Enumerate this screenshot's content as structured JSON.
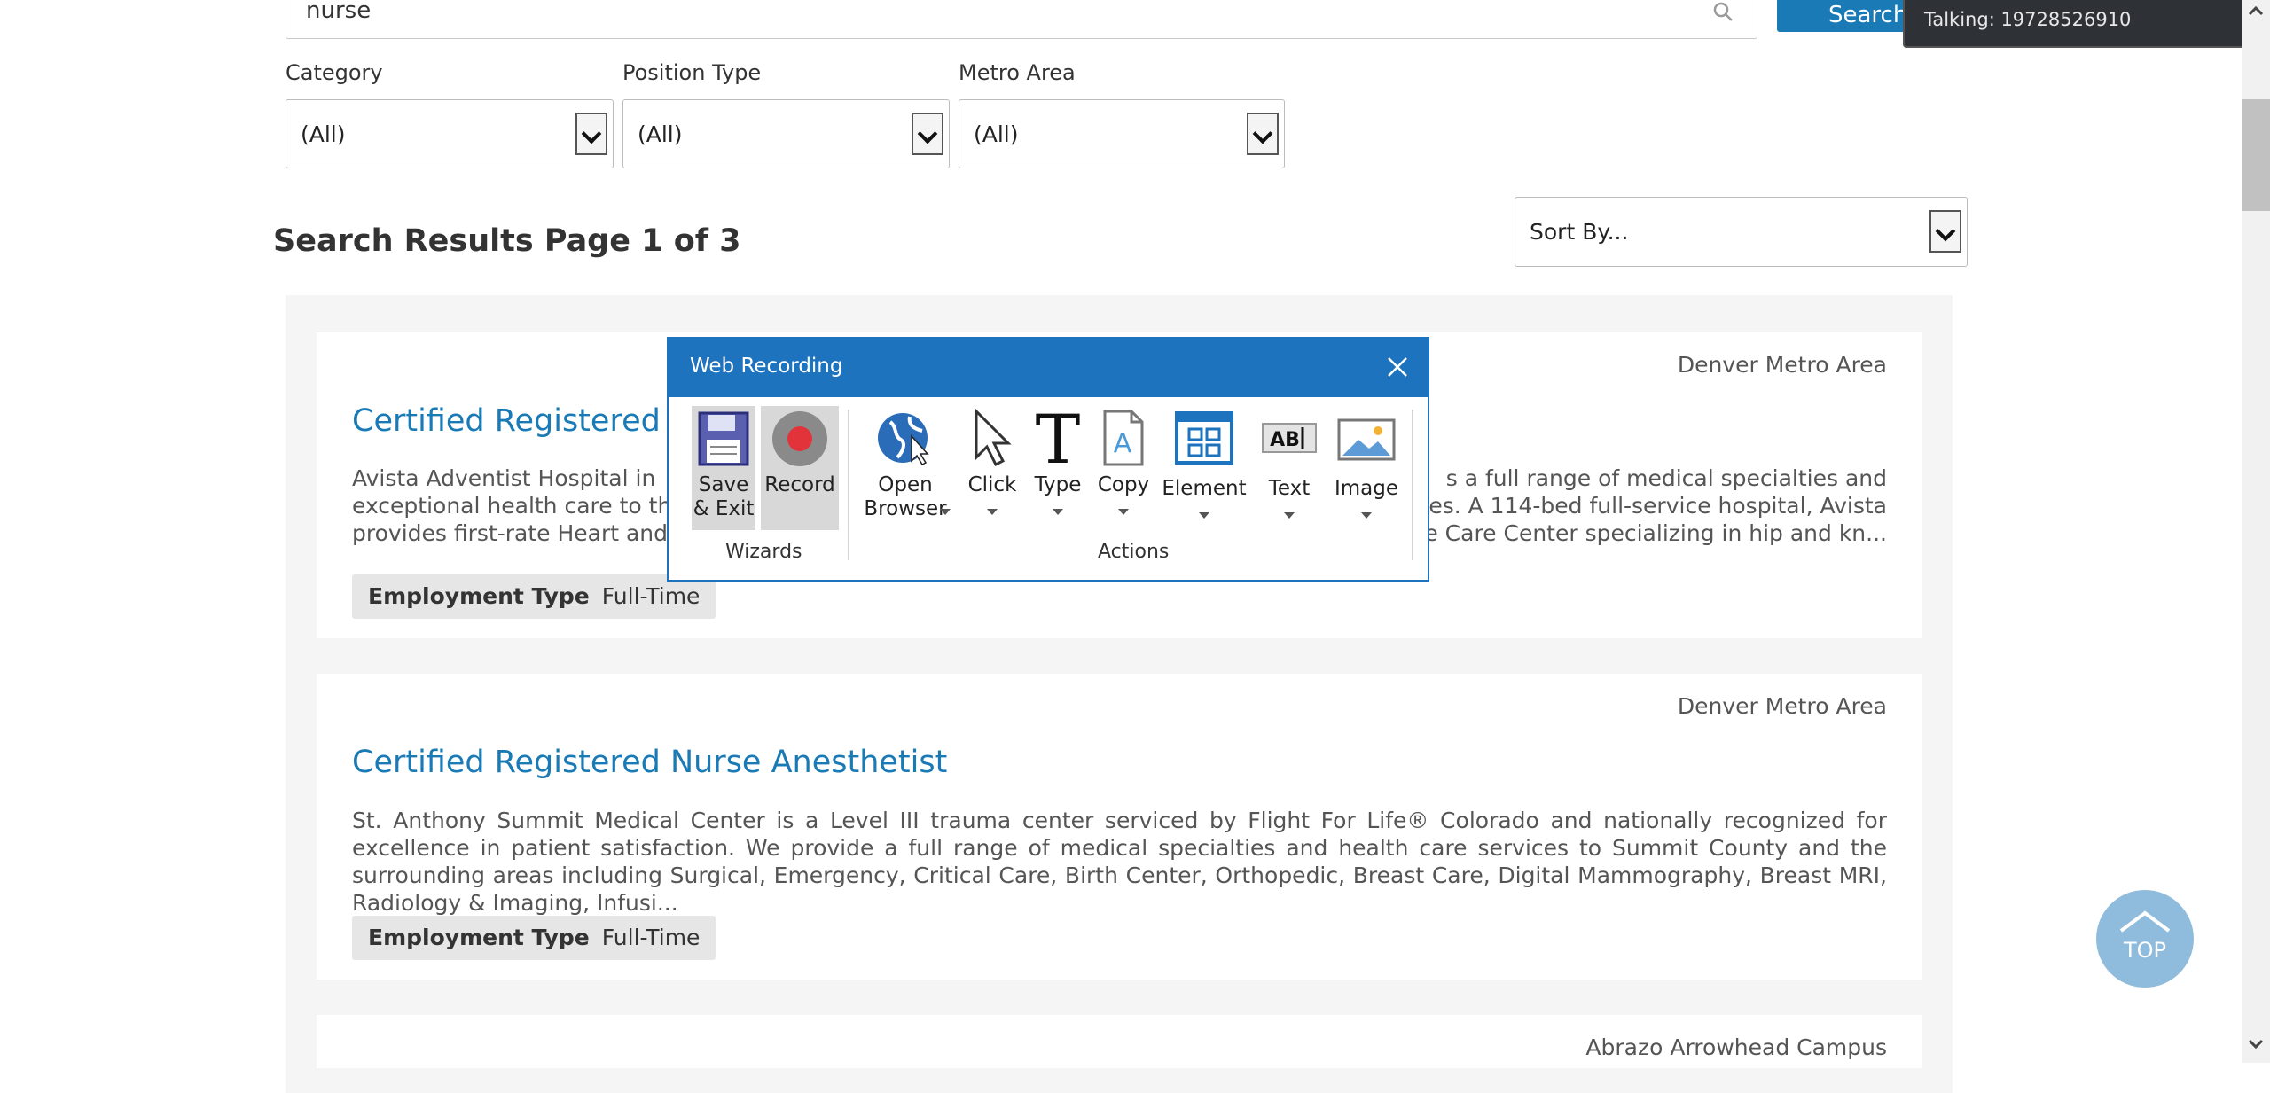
{
  "search": {
    "value": "nurse",
    "button_label": "Search"
  },
  "tooltip": {
    "text": "Talking: 19728526910"
  },
  "filters": [
    {
      "label": "Category",
      "value": "(All)"
    },
    {
      "label": "Position Type",
      "value": "(All)"
    },
    {
      "label": "Metro Area",
      "value": "(All)"
    }
  ],
  "sort": {
    "value": "Sort By..."
  },
  "results_title": "Search Results Page 1 of 3",
  "results": [
    {
      "location": "Denver Metro Area",
      "title": "Certified Registered N",
      "desc_line1_left": "Avista Adventist Hospital in",
      "desc_line1_right": "s a full range of medical specialties and",
      "desc_line2_left": "exceptional health care to the",
      "desc_line2_right": "ities. A 114-bed full-service hospital, Avista",
      "desc_line3_left": "provides first-rate Heart and V",
      "desc_line3_right": "ne Care Center specializing in hip and kn...",
      "employment_type_label": "Employment Type",
      "employment_type_value": "Full-Time"
    },
    {
      "location": "Denver Metro Area",
      "title": "Certified Registered Nurse Anesthetist",
      "description": "St. Anthony Summit Medical Center is a Level III trauma center serviced by Flight For Life® Colorado and nationally recognized for excellence in patient satisfaction. We provide a full range of medical specialties and health care services to Summit County and the surrounding areas including Surgical, Emergency, Critical Care, Birth Center, Orthopedic, Breast Care, Digital Mammography, Breast MRI, Radiology & Imaging, Infusi...",
      "employment_type_label": "Employment Type",
      "employment_type_value": "Full-Time"
    },
    {
      "location": "Abrazo Arrowhead Campus"
    }
  ],
  "recorder": {
    "title": "Web Recording",
    "wizards_label": "Wizards",
    "actions_label": "Actions",
    "tools": {
      "save_exit_1": "Save",
      "save_exit_2": "& Exit",
      "record": "Record",
      "open_browser_1": "Open",
      "open_browser_2": "Browser",
      "click": "Click",
      "type": "Type",
      "copy": "Copy",
      "element": "Element",
      "text": "Text",
      "image": "Image"
    }
  },
  "top_button": {
    "label": "TOP"
  }
}
